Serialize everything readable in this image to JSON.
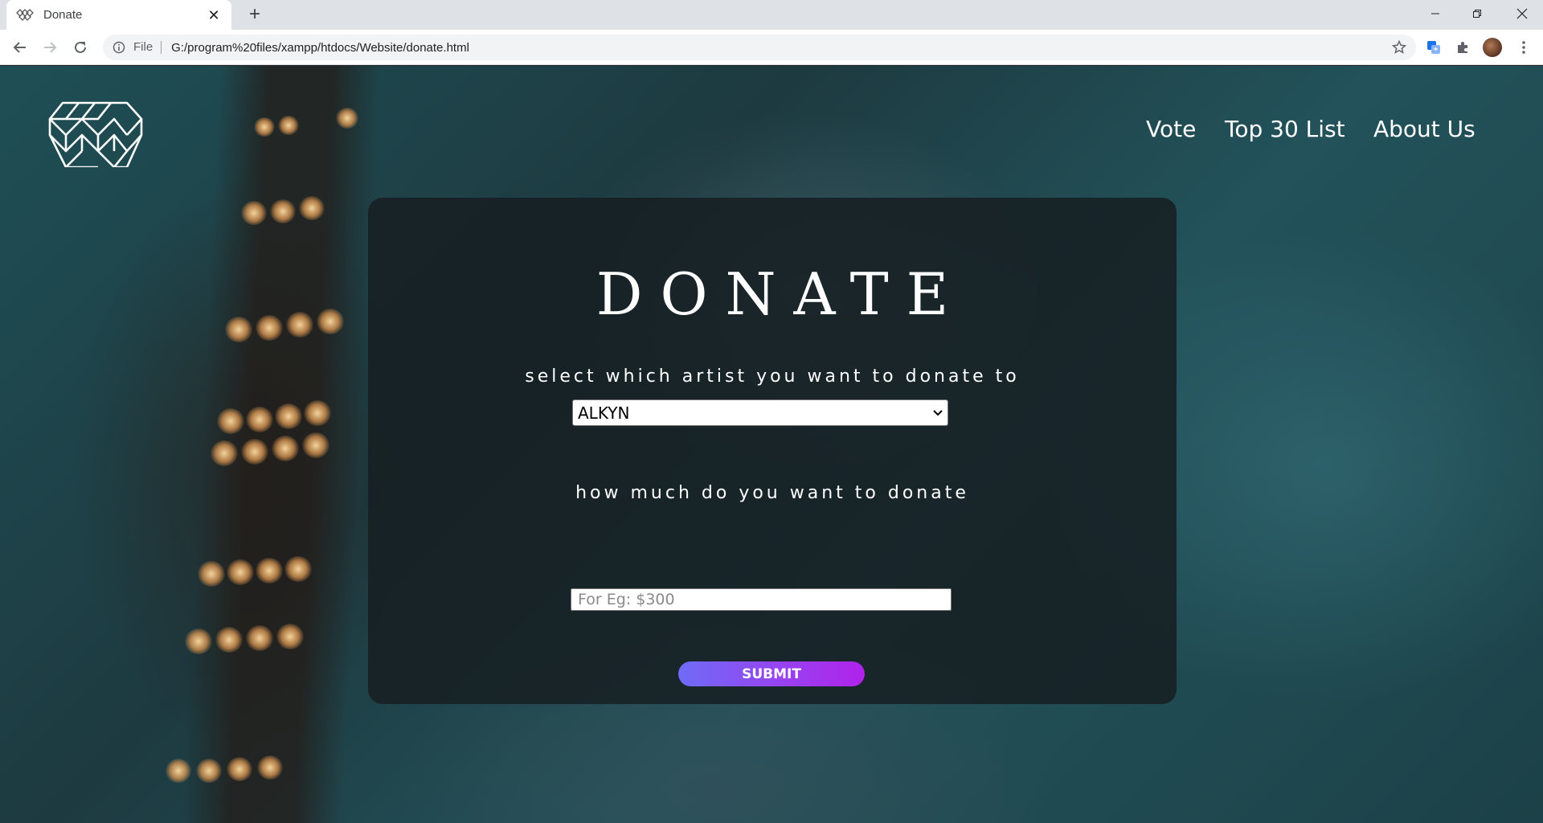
{
  "browser": {
    "tab": {
      "title": "Donate",
      "favicon": "site-logo-icon",
      "close_icon": "close-icon"
    },
    "new_tab_icon": "plus-icon",
    "window_controls": [
      "minimize-icon",
      "restore-icon",
      "close-icon"
    ],
    "toolbar": {
      "back_icon": "back-arrow-icon",
      "forward_icon": "forward-arrow-icon",
      "reload_icon": "reload-icon",
      "omnibox": {
        "info_icon": "info-icon",
        "scheme": "File",
        "url": "G:/program%20files/xampp/htdocs/Website/donate.html",
        "bookmark_icon": "star-icon"
      },
      "extensions": [
        "translate-extension-icon",
        "puzzle-icon",
        "profile-avatar",
        "kebab-menu-icon"
      ]
    }
  },
  "site": {
    "logo": "diamond-lattice-logo",
    "nav": [
      {
        "label": "Vote"
      },
      {
        "label": "Top 30 List"
      },
      {
        "label": "About Us"
      }
    ]
  },
  "donate_form": {
    "heading": "DONATE",
    "artist_label": "select which artist you want to donate to",
    "artist_select": {
      "selected": "ALKYN"
    },
    "amount_label": "how much do you want to donate",
    "amount_input": {
      "value": "",
      "placeholder": "For Eg: $300"
    },
    "submit_label": "SUBMIT"
  },
  "colors": {
    "card_bg": "#161e22",
    "submit_gradient_start": "#6f6cf7",
    "submit_gradient_end": "#b022ea",
    "background_teal": "#1f4f56"
  }
}
